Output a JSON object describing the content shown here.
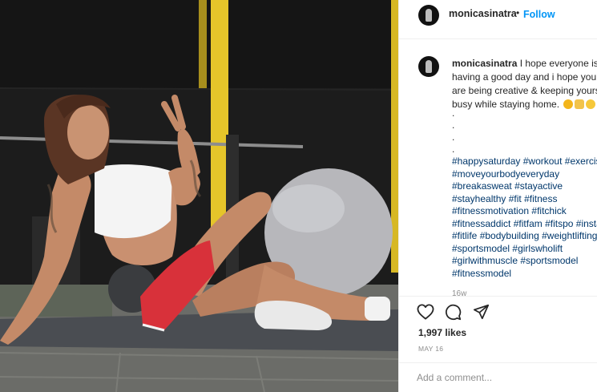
{
  "post": {
    "author": "monicasinatra",
    "header": {
      "username": "monicasinatra",
      "separator": "•",
      "follow_label": "Follow"
    },
    "caption": {
      "username": "monicasinatra",
      "text": "I hope everyone is having a good day and i hope you are being creative & keeping yourself busy while staying home.",
      "emojis": [
        "sun-emoji",
        "flexed-biceps-emoji",
        "smiling-face-emoji"
      ],
      "dots": [
        ".",
        ".",
        ".",
        "."
      ]
    },
    "hashtags": [
      "#happysaturday",
      "#workout",
      "#exercise",
      "#moveyourbodyeveryday",
      "#breakasweat",
      "#stayactive",
      "#stayhealthy",
      "#fit",
      "#fitness",
      "#fitnessmotivation",
      "#fitchick",
      "#fitnessaddict",
      "#fitfam",
      "#fitspo",
      "#instafit",
      "#fitlife",
      "#bodybuilding",
      "#weightlifting",
      "#sportsmodel",
      "#girlswholift",
      "#girlwithmuscle",
      "#sportsmodel",
      "#fitnessmodel"
    ],
    "comment_time": "16w",
    "likes": "1,997 likes",
    "date": "MAY 16",
    "add_comment_placeholder": "Add a comment...",
    "icons": {
      "like": "heart-icon",
      "comment": "comment-icon",
      "share": "paper-plane-icon"
    }
  },
  "photo": {
    "description_icon": "fitness-photo",
    "colors": {
      "wall": "#1b1b1b",
      "pillar": "#e8c82a",
      "floor": "#6d6e6a",
      "mat": "#4b4e53",
      "ball": "#b8b8bc",
      "shorts": "#d9323b",
      "top": "#f4f4f4",
      "skin": "#c58c6a"
    }
  },
  "theme": {
    "link": "#00376b",
    "accent": "#0095f6",
    "text": "#262626",
    "muted": "#8e8e8e"
  }
}
